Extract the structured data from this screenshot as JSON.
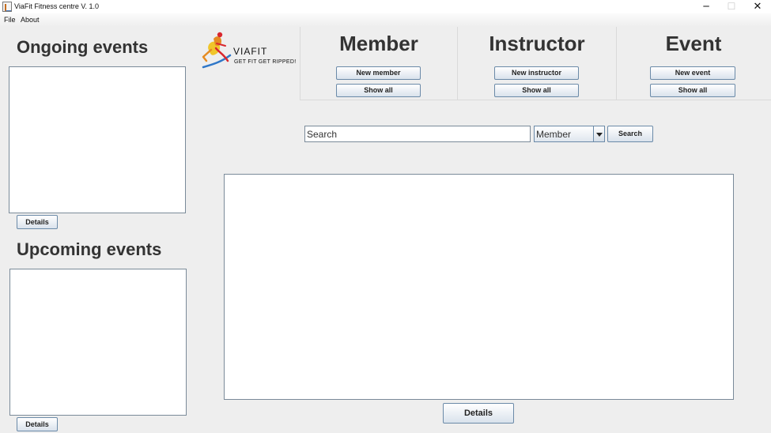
{
  "window": {
    "title": "ViaFit Fitness centre V. 1.0",
    "icon": "app-icon",
    "controls": {
      "minimize": "─",
      "maximize": "☐",
      "close": "✕"
    }
  },
  "menu": {
    "file": "File",
    "about": "About"
  },
  "sidebar": {
    "ongoing": {
      "title": "Ongoing events",
      "details_label": "Details"
    },
    "upcoming": {
      "title": "Upcoming events",
      "details_label": "Details"
    }
  },
  "logo": {
    "brand": "VIAFIT",
    "tagline": "GET FIT GET RIPPED!",
    "colors": {
      "orange": "#e58b22",
      "yellow": "#f0c52a",
      "red": "#d9272e",
      "blue": "#2f77c8"
    }
  },
  "categories": {
    "member": {
      "title": "Member",
      "new_label": "New member",
      "show_all_label": "Show all"
    },
    "instructor": {
      "title": "Instructor",
      "new_label": "New instructor",
      "show_all_label": "Show all"
    },
    "event": {
      "title": "Event",
      "new_label": "New event",
      "show_all_label": "Show all"
    }
  },
  "search": {
    "placeholder": "Search",
    "value": "",
    "category_selected": "Member",
    "button_label": "Search"
  },
  "main": {
    "details_label": "Details"
  },
  "colors": {
    "background": "#eeeeee",
    "button_border": "#6b8aa8",
    "title_text": "#333333"
  }
}
